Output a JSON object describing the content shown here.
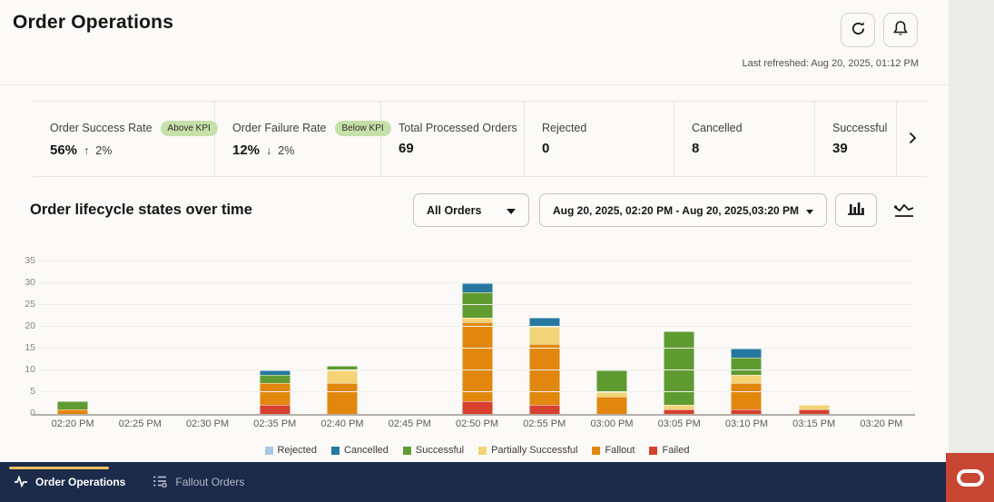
{
  "header": {
    "title": "Order Operations",
    "last_refreshed": "Last refreshed: Aug 20, 2025, 01:12 PM"
  },
  "kpis": [
    {
      "label": "Order Success Rate",
      "badge": "Above KPI",
      "value": "56%",
      "delta_arrow": "↑",
      "delta": "2%"
    },
    {
      "label": "Order Failure Rate",
      "badge": "Below KPI",
      "value": "12%",
      "delta_arrow": "↓",
      "delta": "2%"
    },
    {
      "label": "Total Processed Orders",
      "value": "69"
    },
    {
      "label": "Rejected",
      "value": "0"
    },
    {
      "label": "Cancelled",
      "value": "8"
    },
    {
      "label": "Successful",
      "value": "39"
    }
  ],
  "chart_section": {
    "title": "Order lifecycle states over time",
    "orders_filter_value": "All Orders",
    "date_range_value": "Aug 20, 2025, 02:20 PM - Aug 20, 2025,03:20 PM"
  },
  "chart_data": {
    "type": "bar",
    "stacked": true,
    "title": "Order lifecycle states over time",
    "xlabel": "",
    "ylabel": "",
    "ylim": [
      0,
      35
    ],
    "yticks": [
      0,
      5,
      10,
      15,
      20,
      25,
      30,
      35
    ],
    "grid": true,
    "legend_position": "bottom",
    "categories": [
      "02:20 PM",
      "02:25 PM",
      "02:30 PM",
      "02:35 PM",
      "02:40 PM",
      "02:45 PM",
      "02:50 PM",
      "02:55 PM",
      "03:00 PM",
      "03:05 PM",
      "03:10 PM",
      "03:15 PM",
      "03:20 PM"
    ],
    "series": [
      {
        "name": "Failed",
        "color": "#d6402c",
        "values": [
          0,
          0,
          0,
          2,
          0,
          0,
          3,
          2,
          0,
          1,
          1,
          1,
          0
        ]
      },
      {
        "name": "Fallout",
        "color": "#e1870e",
        "values": [
          1,
          0,
          0,
          5,
          7,
          0,
          18,
          14,
          4,
          0,
          6,
          0,
          0
        ]
      },
      {
        "name": "Partially Successful",
        "color": "#f2d376",
        "values": [
          0,
          0,
          0,
          0,
          3,
          0,
          1,
          4,
          1,
          1,
          2,
          1,
          0
        ]
      },
      {
        "name": "Successful",
        "color": "#5f9b31",
        "values": [
          2,
          0,
          0,
          2,
          1,
          0,
          6,
          0,
          5,
          17,
          4,
          0,
          0
        ]
      },
      {
        "name": "Cancelled",
        "color": "#2678a0",
        "values": [
          0,
          0,
          0,
          1,
          0,
          0,
          2,
          2,
          0,
          0,
          2,
          0,
          0
        ]
      },
      {
        "name": "Rejected",
        "color": "#a9c6e2",
        "values": [
          0,
          0,
          0,
          0,
          0,
          0,
          0,
          0,
          0,
          0,
          0,
          0,
          0
        ]
      }
    ],
    "legend": [
      {
        "label": "Rejected",
        "color": "#a9c6e2"
      },
      {
        "label": "Cancelled",
        "color": "#2678a0"
      },
      {
        "label": "Successful",
        "color": "#5f9b31"
      },
      {
        "label": "Partially Successful",
        "color": "#f2d376"
      },
      {
        "label": "Fallout",
        "color": "#e1870e"
      },
      {
        "label": "Failed",
        "color": "#d6402c"
      }
    ]
  },
  "nav": {
    "items": [
      {
        "label": "Order Operations",
        "active": true
      },
      {
        "label": "Fallout Orders",
        "active": false
      }
    ]
  },
  "colors": {
    "accent_gold": "#efc15e",
    "oracle_red": "#c74634",
    "kpi_badge_green": "#c5e0a9",
    "nav_bg": "#1c2b4a"
  }
}
